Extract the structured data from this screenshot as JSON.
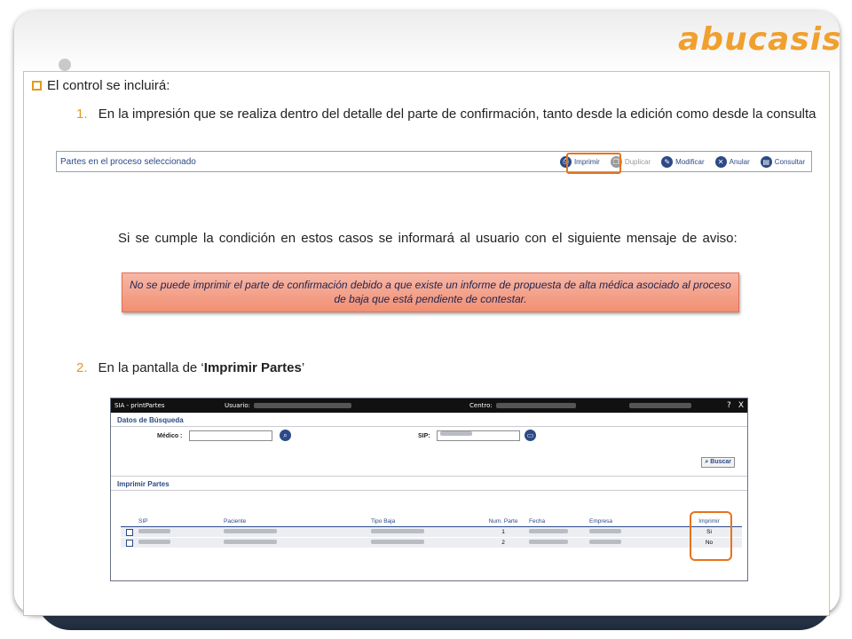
{
  "logo": "abucasis",
  "bullet": {
    "text": "El control se incluirá:"
  },
  "item1": {
    "number": "1.",
    "text": "En la impresión que se realiza dentro del detalle del parte de confirmación, tanto desde la edición como desde la consulta"
  },
  "toolbar": {
    "title": "Partes en el proceso seleccionado",
    "actions": [
      {
        "label": "Imprimir",
        "icon": "printer-icon",
        "enabled": true
      },
      {
        "label": "Duplicar",
        "icon": "duplicate-icon",
        "enabled": false
      },
      {
        "label": "Modificar",
        "icon": "edit-icon",
        "enabled": true
      },
      {
        "label": "Anular",
        "icon": "cancel-icon",
        "enabled": true
      },
      {
        "label": "Consultar",
        "icon": "view-icon",
        "enabled": true
      }
    ]
  },
  "condition": "Si se cumple la condición en estos casos se informará al usuario con el siguiente mensaje de aviso:",
  "warning": "No se puede imprimir el parte de confirmación debido a que existe un informe de propuesta de alta médica asociado al proceso de baja que está pendiente de contestar.",
  "item2": {
    "number": "2.",
    "prefix": "En la pantalla de ‘",
    "bold": "Imprimir Partes",
    "suffix": "’"
  },
  "app": {
    "title": "SIA - printPartes",
    "user_label": "Usuario:",
    "center_label": "Centro:",
    "help": "?",
    "close": "X",
    "search_section": "Datos de Búsqueda",
    "medico_label": "Médico :",
    "sip_label": "SIP:",
    "buscar": "Buscar",
    "print_section": "Imprimir Partes",
    "columns": [
      "SIP",
      "Paciente",
      "Tipo Baja",
      "Num. Parte",
      "Fecha",
      "Empresa",
      "Imprimir"
    ],
    "rows": [
      {
        "num_parte": "1",
        "imprimir": "Si"
      },
      {
        "num_parte": "2",
        "imprimir": "No"
      }
    ]
  },
  "colors": {
    "accent": "#e39a1a",
    "highlight": "#e8721c",
    "link": "#2b4a86",
    "warning_bg": "#f4a58e"
  }
}
